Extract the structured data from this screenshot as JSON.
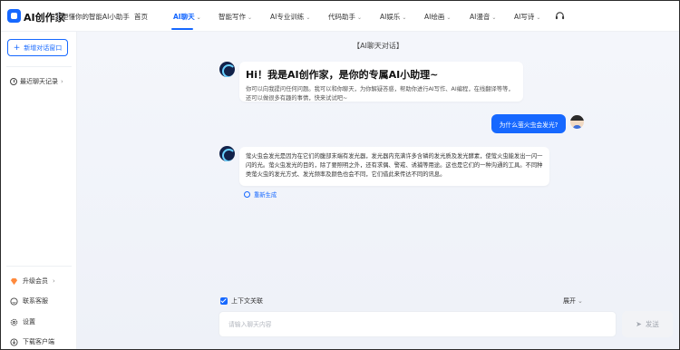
{
  "brand": {
    "name": "AI创作家",
    "slogan": "更懂你的智能AI小助手"
  },
  "nav": {
    "items": [
      {
        "label": "首页",
        "has_chevron": false
      },
      {
        "label": "AI聊天",
        "has_chevron": true,
        "active": true
      },
      {
        "label": "智能写作",
        "has_chevron": true
      },
      {
        "label": "AI专业训练",
        "has_chevron": true
      },
      {
        "label": "代码助手",
        "has_chevron": true
      },
      {
        "label": "AI娱乐",
        "has_chevron": true
      },
      {
        "label": "AI绘画",
        "has_chevron": true
      },
      {
        "label": "AI漫音",
        "has_chevron": true
      },
      {
        "label": "AI写诗",
        "has_chevron": true
      }
    ],
    "accent_color": "#1668ff"
  },
  "sidebar": {
    "new_chat_label": "新增对话窗口",
    "recent_label": "最近聊天记录",
    "bottom_items": [
      {
        "label": "升级会员",
        "icon": "diamond-icon",
        "has_chevron": true
      },
      {
        "label": "联系客服",
        "icon": "service-icon",
        "has_chevron": false
      },
      {
        "label": "设置",
        "icon": "gear-icon",
        "has_chevron": false
      },
      {
        "label": "下载客户端",
        "icon": "download-icon",
        "has_chevron": false
      }
    ]
  },
  "chat": {
    "title": "【AI聊天对话】",
    "greeting_title": "Hi！我是AI创作家，是你的专属AI小助理~",
    "greeting_body": "你可以向我提问任何问题。我可以和你聊天，为你解疑答惑，帮助你进行AI写作、AI编程，在线翻译等等，还可以做很多有趣的事情，快来试试吧~",
    "user_message": "为什么萤火虫会发光?",
    "answer": "萤火虫会发光是因为在它们的腹部末端有发光器，发光器内充满许多含磷的发光质及发光酵素，使萤火虫能发出一闪一闪的光。萤火虫发光的目的，除了要照明之外，还有求偶、警戒、诱捕等用途。这也是它们的一种沟通的工具。不同种类萤火虫的发光方式、发光频率及颜色也会不同，它们借此来传达不同的讯息。",
    "regenerate_label": "重新生成"
  },
  "composer": {
    "context_label": "上下文关联",
    "context_checked": true,
    "expand_label": "展开",
    "placeholder": "请输入聊天内容",
    "send_label": "发送"
  }
}
